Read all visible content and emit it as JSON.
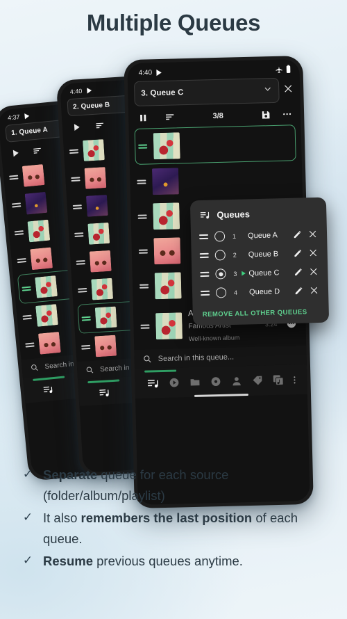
{
  "title": "Multiple Queues",
  "phones": [
    {
      "id": "queue-a",
      "time": "4:37",
      "queue_label": "1. Queue A",
      "count": "",
      "search_placeholder": "Search in this queue..."
    },
    {
      "id": "queue-b",
      "time": "4:40",
      "queue_label": "2. Queue B",
      "count": "",
      "search_placeholder": "Search in this queue..."
    },
    {
      "id": "queue-c",
      "time": "4:40",
      "queue_label": "3. Queue C",
      "count": "3/8",
      "search_placeholder": "Search in this queue...",
      "now_playing": {
        "title": "Awesome Title",
        "artist": "Famous Artist",
        "album": "Well-known album",
        "duration": "3:24"
      }
    }
  ],
  "dialog": {
    "title": "Queues",
    "rows": [
      {
        "num": "1",
        "name": "Queue A",
        "selected": false,
        "playing": false
      },
      {
        "num": "2",
        "name": "Queue B",
        "selected": false,
        "playing": false
      },
      {
        "num": "3",
        "name": "Queue C",
        "selected": true,
        "playing": true
      },
      {
        "num": "4",
        "name": "Queue D",
        "selected": false,
        "playing": false
      }
    ],
    "action_label": "REMOVE ALL OTHER QUEUES"
  },
  "bullets": [
    {
      "check": "✓",
      "pre_bold": "Separate",
      "rest": " queue for each source (folder/album/playlist)"
    },
    {
      "check": "✓",
      "pre": "It also ",
      "bold": "remembers the last position",
      "rest": " of each queue."
    },
    {
      "check": "✓",
      "pre_bold": "Resume",
      "rest": " previous queues anytime."
    }
  ],
  "colors": {
    "accent_green": "#5fd18f",
    "dark_bg": "#121212",
    "dialog_bg": "#2f2f2f",
    "title_text": "#2b3a44"
  },
  "icons": {
    "play": "play-icon",
    "pause": "pause-icon",
    "sort": "sort-icon",
    "save": "save-icon",
    "overflow": "overflow-icon",
    "close": "close-icon",
    "chevron": "chevron-down-icon",
    "search": "search-icon",
    "edit": "edit-icon"
  }
}
